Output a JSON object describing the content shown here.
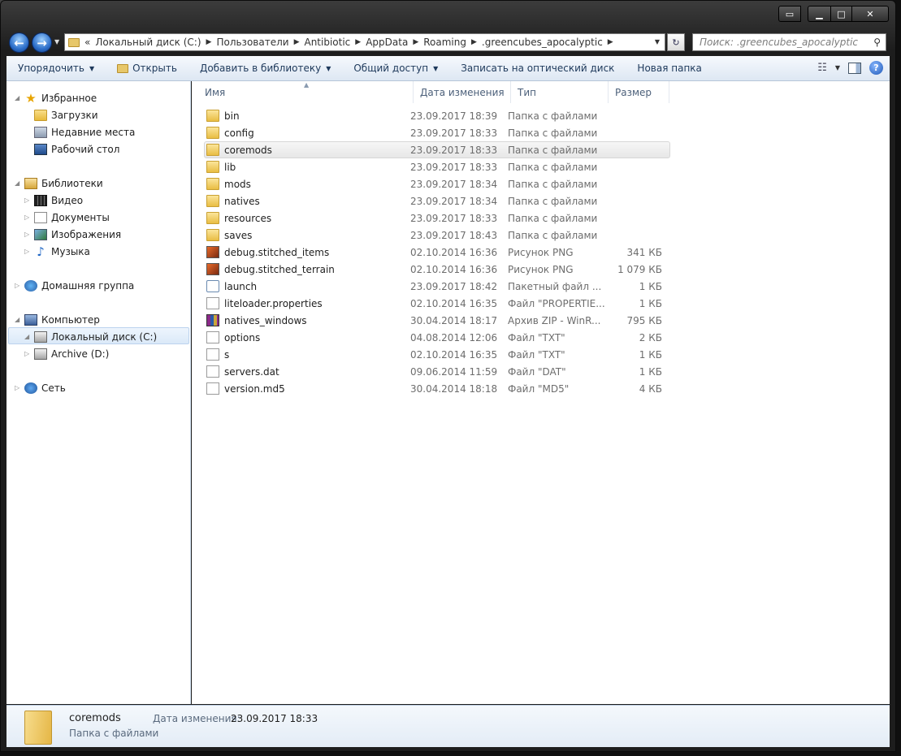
{
  "nav": {
    "breadcrumb_prefix": "«",
    "breadcrumbs": [
      "Локальный диск (C:)",
      "Пользователи",
      "Antibiotic",
      "AppData",
      "Roaming",
      ".greencubes_apocalyptic"
    ],
    "search_placeholder": "Поиск: .greencubes_apocalyptic"
  },
  "toolbar": {
    "organize": "Упорядочить",
    "open": "Открыть",
    "add_to_library": "Добавить в библиотеку",
    "share": "Общий доступ",
    "burn": "Записать на оптический диск",
    "new_folder": "Новая папка"
  },
  "sidebar": {
    "favorites": "Избранное",
    "downloads": "Загрузки",
    "recent": "Недавние места",
    "desktop": "Рабочий стол",
    "libraries": "Библиотеки",
    "video": "Видео",
    "documents": "Документы",
    "images": "Изображения",
    "music": "Музыка",
    "homegroup": "Домашняя группа",
    "computer": "Компьютер",
    "local_disk": "Локальный диск (C:)",
    "archive": "Archive (D:)",
    "network": "Сеть"
  },
  "columns": {
    "name": "Имя",
    "date": "Дата изменения",
    "type": "Тип",
    "size": "Размер"
  },
  "files": [
    {
      "name": "bin",
      "date": "23.09.2017 18:39",
      "type": "Папка с файлами",
      "size": ""
    },
    {
      "name": "config",
      "date": "23.09.2017 18:33",
      "type": "Папка с файлами",
      "size": ""
    },
    {
      "name": "coremods",
      "date": "23.09.2017 18:33",
      "type": "Папка с файлами",
      "size": ""
    },
    {
      "name": "lib",
      "date": "23.09.2017 18:33",
      "type": "Папка с файлами",
      "size": ""
    },
    {
      "name": "mods",
      "date": "23.09.2017 18:34",
      "type": "Папка с файлами",
      "size": ""
    },
    {
      "name": "natives",
      "date": "23.09.2017 18:34",
      "type": "Папка с файлами",
      "size": ""
    },
    {
      "name": "resources",
      "date": "23.09.2017 18:33",
      "type": "Папка с файлами",
      "size": ""
    },
    {
      "name": "saves",
      "date": "23.09.2017 18:43",
      "type": "Папка с файлами",
      "size": ""
    },
    {
      "name": "debug.stitched_items",
      "date": "02.10.2014 16:36",
      "type": "Рисунок PNG",
      "size": "341 КБ"
    },
    {
      "name": "debug.stitched_terrain",
      "date": "02.10.2014 16:36",
      "type": "Рисунок PNG",
      "size": "1 079 КБ"
    },
    {
      "name": "launch",
      "date": "23.09.2017 18:42",
      "type": "Пакетный файл ...",
      "size": "1 КБ"
    },
    {
      "name": "liteloader.properties",
      "date": "02.10.2014 16:35",
      "type": "Файл \"PROPERTIE...",
      "size": "1 КБ"
    },
    {
      "name": "natives_windows",
      "date": "30.04.2014 18:17",
      "type": "Архив ZIP - WinR...",
      "size": "795 КБ"
    },
    {
      "name": "options",
      "date": "04.08.2014 12:06",
      "type": "Файл \"TXT\"",
      "size": "2 КБ"
    },
    {
      "name": "s",
      "date": "02.10.2014 16:35",
      "type": "Файл \"TXT\"",
      "size": "1 КБ"
    },
    {
      "name": "servers.dat",
      "date": "09.06.2014 11:59",
      "type": "Файл \"DAT\"",
      "size": "1 КБ"
    },
    {
      "name": "version.md5",
      "date": "30.04.2014 18:18",
      "type": "Файл \"MD5\"",
      "size": "4 КБ"
    }
  ],
  "details": {
    "name": "coremods",
    "type": "Папка с файлами",
    "date_label": "Дата изменения:",
    "date": "23.09.2017 18:33"
  }
}
